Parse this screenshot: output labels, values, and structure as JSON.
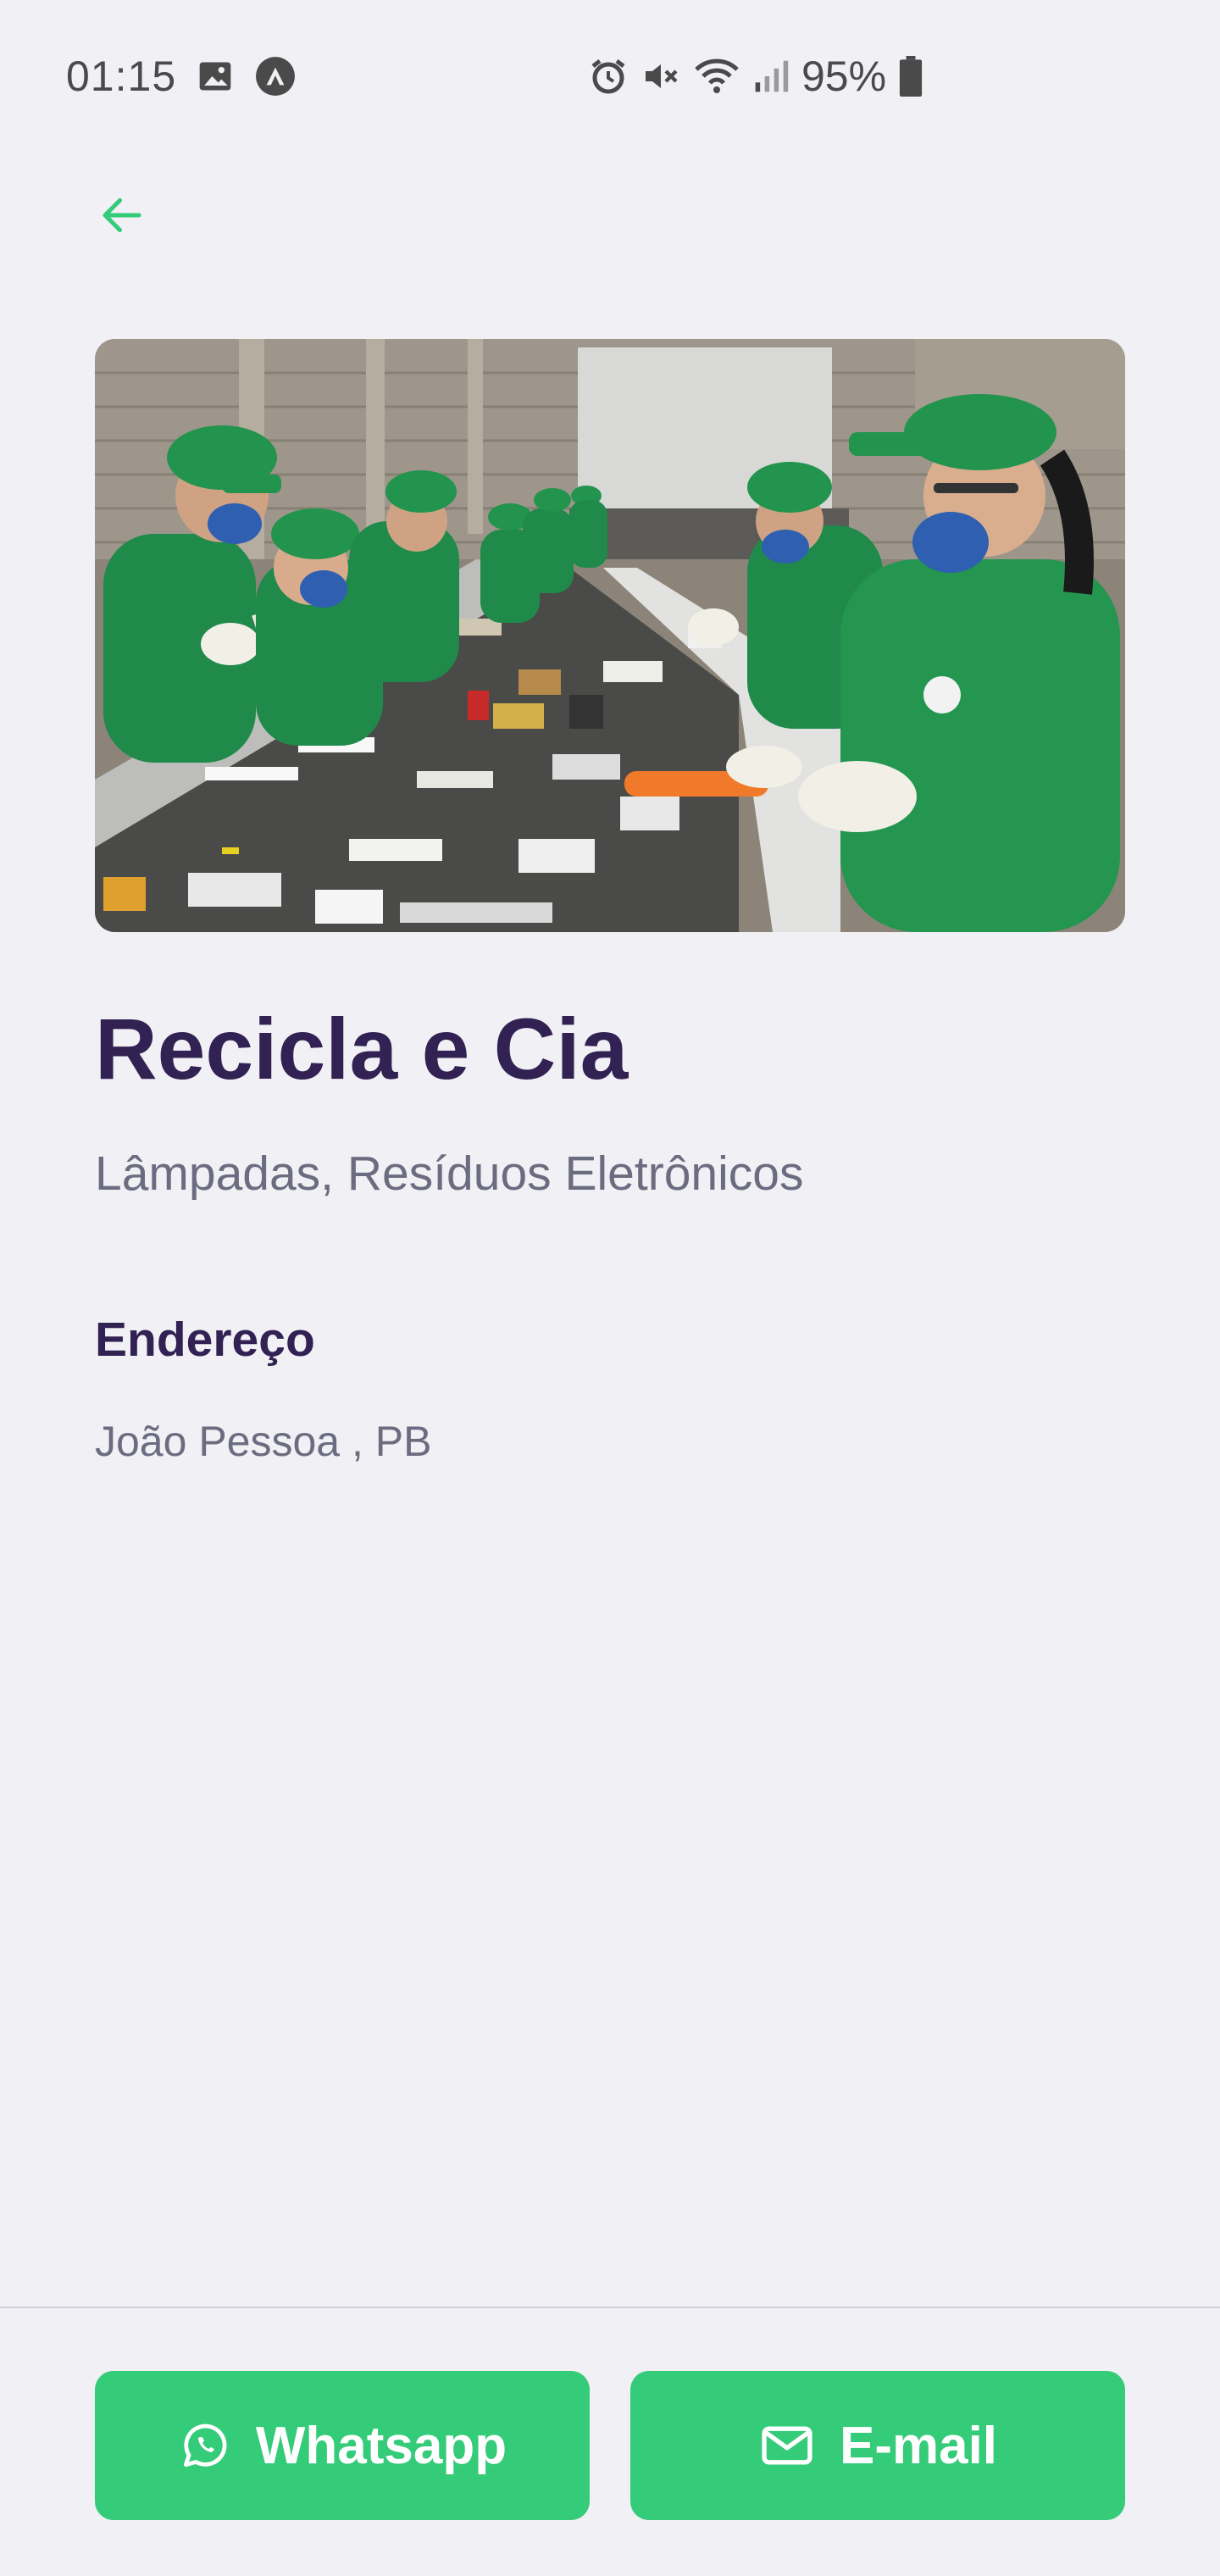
{
  "status_bar": {
    "time": "01:15",
    "battery": "95%",
    "icons": [
      "gallery-icon",
      "app-notification-icon",
      "alarm-icon",
      "mute-icon",
      "wifi-icon",
      "signal-icon",
      "battery-icon"
    ]
  },
  "navigation": {
    "back_icon": "arrow-left-icon"
  },
  "point": {
    "name": "Recicla e Cia",
    "items": "Lâmpadas, Resíduos Eletrônicos",
    "address_label": "Endereço",
    "address": "João Pessoa , PB"
  },
  "actions": {
    "whatsapp_label": "Whatsapp",
    "email_label": "E-mail"
  },
  "colors": {
    "background": "#F0F0F5",
    "primary": "#34CB79",
    "title": "#322153",
    "text": "#6C6C80"
  }
}
